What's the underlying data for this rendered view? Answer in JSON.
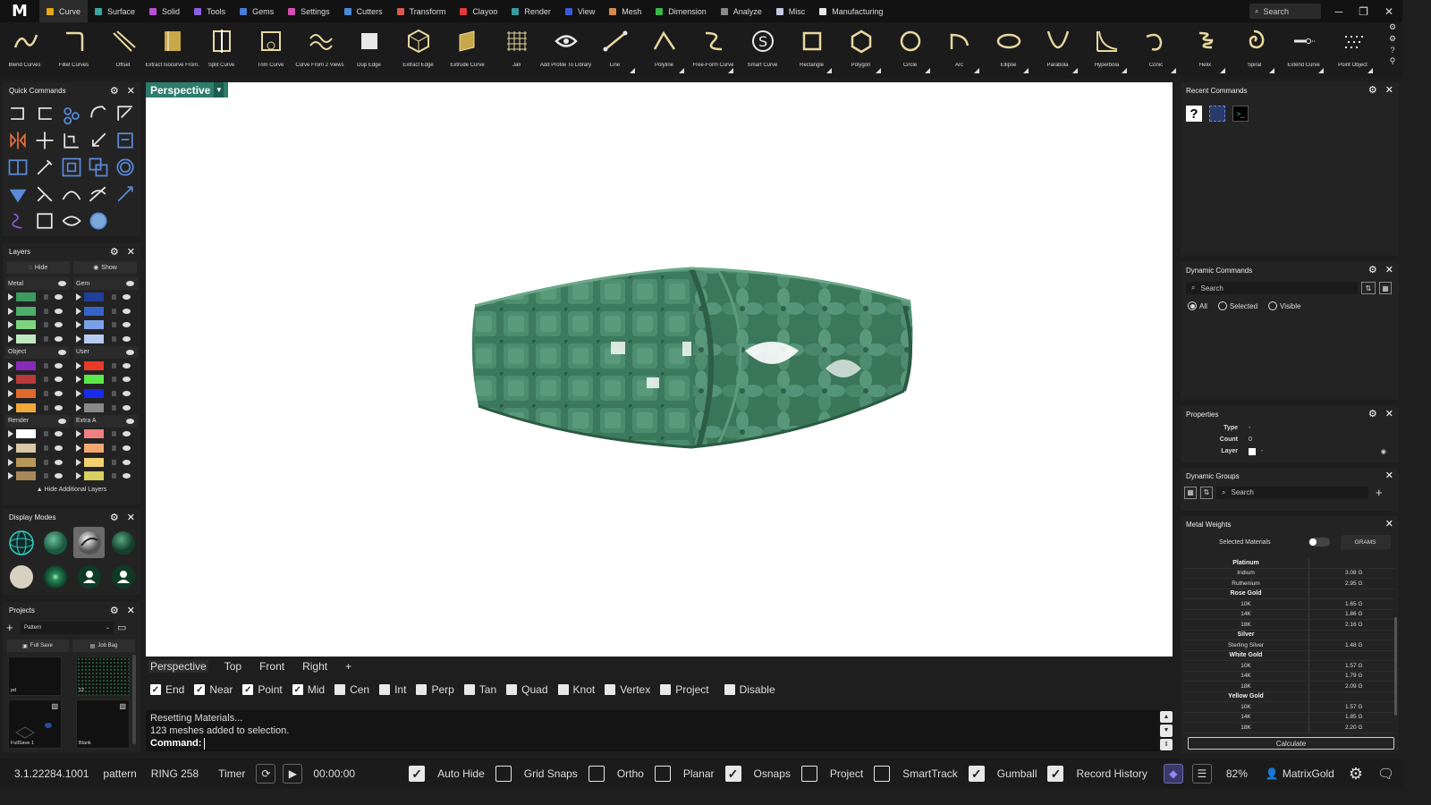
{
  "app": {
    "logo": "M"
  },
  "tabs": [
    {
      "label": "Curve",
      "color": "#e6a817",
      "active": true
    },
    {
      "label": "Surface",
      "color": "#3aa7a0"
    },
    {
      "label": "Solid",
      "color": "#b84fd6"
    },
    {
      "label": "Tools",
      "color": "#8a5fe0"
    },
    {
      "label": "Gems",
      "color": "#4a7bd8"
    },
    {
      "label": "Settings",
      "color": "#d64fb0"
    },
    {
      "label": "Cutters",
      "color": "#4a8ad8"
    },
    {
      "label": "Transform",
      "color": "#d65a4f"
    },
    {
      "label": "Clayoo",
      "color": "#e03a3a"
    },
    {
      "label": "Render",
      "color": "#3a9aa0"
    },
    {
      "label": "View",
      "color": "#3a5ad8"
    },
    {
      "label": "Mesh",
      "color": "#d68a4f"
    },
    {
      "label": "Dimension",
      "color": "#3ab84f"
    },
    {
      "label": "Analyze",
      "color": "#888888"
    },
    {
      "label": "Misc",
      "color": "#c8c8e8"
    },
    {
      "label": "Manufacturing",
      "color": "#e8e8e8"
    }
  ],
  "search": {
    "placeholder": "Search"
  },
  "window": {
    "minimize": "─",
    "restore": "❐",
    "close": "✕"
  },
  "tools": [
    {
      "label": "Blend Curves",
      "icon": "blend-curves",
      "corner": false
    },
    {
      "label": "Fillet Curves",
      "icon": "fillet-curves",
      "corner": false
    },
    {
      "label": "Offset",
      "icon": "offset",
      "corner": false
    },
    {
      "label": "Extract Isocurve From...",
      "icon": "extract-isocurve",
      "corner": false
    },
    {
      "label": "Split Curve",
      "icon": "split-curve",
      "corner": false
    },
    {
      "label": "Trim Curve",
      "icon": "trim-curve",
      "corner": false
    },
    {
      "label": "Curve From 2 Views",
      "icon": "curve-2-views",
      "corner": false
    },
    {
      "label": "Dup Edge",
      "icon": "dup-edge",
      "corner": false
    },
    {
      "label": "Extract Edge",
      "icon": "extract-edge",
      "corner": false
    },
    {
      "label": "Extrude Curve",
      "icon": "extrude-curve",
      "corner": false
    },
    {
      "label": "Jali",
      "icon": "jali",
      "corner": false
    },
    {
      "label": "Add Profile To Library",
      "icon": "add-profile",
      "corner": false
    },
    {
      "label": "Line",
      "icon": "line",
      "corner": true
    },
    {
      "label": "Polyline",
      "icon": "polyline",
      "corner": true
    },
    {
      "label": "Free-Form Curve",
      "icon": "free-form-curve",
      "corner": true
    },
    {
      "label": "Smart Curve",
      "icon": "smart-curve",
      "corner": false
    },
    {
      "label": "Rectangle",
      "icon": "rectangle",
      "corner": true
    },
    {
      "label": "Polygon",
      "icon": "polygon",
      "corner": true
    },
    {
      "label": "Circle",
      "icon": "circle",
      "corner": true
    },
    {
      "label": "Arc",
      "icon": "arc",
      "corner": true
    },
    {
      "label": "Ellipse",
      "icon": "ellipse",
      "corner": true
    },
    {
      "label": "Parabola",
      "icon": "parabola",
      "corner": true
    },
    {
      "label": "Hyperbola",
      "icon": "hyperbola",
      "corner": true
    },
    {
      "label": "Conic",
      "icon": "conic",
      "corner": true
    },
    {
      "label": "Helix",
      "icon": "helix",
      "corner": true
    },
    {
      "label": "Spiral",
      "icon": "spiral",
      "corner": true
    },
    {
      "label": "Extend Curve",
      "icon": "extend-curve",
      "corner": true
    },
    {
      "label": "Point Object",
      "icon": "point-object",
      "corner": true
    }
  ],
  "panels": {
    "quick_commands": "Quick Commands",
    "layers": "Layers",
    "display_modes": "Display Modes",
    "projects": "Projects",
    "recent_commands": "Recent Commands",
    "dynamic_commands": "Dynamic Commands",
    "properties": "Properties",
    "dynamic_groups": "Dynamic Groups",
    "metal_weights": "Metal Weights"
  },
  "layers": {
    "hide": "Hide",
    "show": "Show",
    "groups": [
      {
        "name": "Metal",
        "colors": [
          "#3c9a5f",
          "#4cae6b",
          "#7cd47e",
          "#bfe8c0"
        ]
      },
      {
        "name": "Gem",
        "colors": [
          "#1f3f9a",
          "#3564c8",
          "#7aa0e8",
          "#b8ccf0"
        ]
      },
      {
        "name": "Object",
        "colors": [
          "#8a2bb8",
          "#b83a3a",
          "#e06a2a",
          "#f0a83a"
        ]
      },
      {
        "name": "User",
        "colors": [
          "#e83a2a",
          "#5ae84a",
          "#1a2ae8",
          "#888888"
        ]
      },
      {
        "name": "Render",
        "colors": [
          "#ffffff",
          "#d8c8a8",
          "#b89858",
          "#a88858"
        ]
      },
      {
        "name": "Extra A",
        "colors": [
          "#f08080",
          "#f0a870",
          "#f0d070",
          "#d8d060"
        ]
      }
    ],
    "hide_additional": "Hide Additional Layers"
  },
  "projects": {
    "dropdown": "Pattern",
    "full_save": "Full Save",
    "job_bag": "Job Bag",
    "thumbs": [
      "pd",
      "12",
      "FullSave 1",
      "Blank"
    ]
  },
  "viewport": {
    "active_label": "Perspective",
    "tabs": [
      "Perspective",
      "Top",
      "Front",
      "Right",
      "+"
    ]
  },
  "snaps": [
    {
      "label": "End",
      "on": true
    },
    {
      "label": "Near",
      "on": true
    },
    {
      "label": "Point",
      "on": true
    },
    {
      "label": "Mid",
      "on": true
    },
    {
      "label": "Cen",
      "on": false
    },
    {
      "label": "Int",
      "on": false
    },
    {
      "label": "Perp",
      "on": false
    },
    {
      "label": "Tan",
      "on": false
    },
    {
      "label": "Quad",
      "on": false
    },
    {
      "label": "Knot",
      "on": false
    },
    {
      "label": "Vertex",
      "on": false
    },
    {
      "label": "Project",
      "on": false
    },
    {
      "label": "Disable",
      "on": false
    }
  ],
  "command": {
    "lines": [
      "Resetting Materials...",
      "123 meshes added to selection."
    ],
    "prompt": "Command:"
  },
  "dynamic_commands": {
    "search": "Search",
    "filters": [
      {
        "label": "All",
        "on": true
      },
      {
        "label": "Selected",
        "on": false
      },
      {
        "label": "Visible",
        "on": false
      }
    ]
  },
  "properties": {
    "rows": [
      {
        "k": "Type",
        "v": "-"
      },
      {
        "k": "Count",
        "v": "0"
      },
      {
        "k": "Layer",
        "v": "-"
      }
    ]
  },
  "dynamic_groups": {
    "search": "Search"
  },
  "metal_weights": {
    "selected_materials": "Selected Materials",
    "unit": "GRAMS",
    "calculate": "Calculate",
    "rows": [
      {
        "name": "Platinum",
        "group": true,
        "value": ""
      },
      {
        "name": "Iridium",
        "group": false,
        "value": "3.08 G"
      },
      {
        "name": "Ruthenium",
        "group": false,
        "value": "2.95 G"
      },
      {
        "name": "Rose Gold",
        "group": true,
        "value": ""
      },
      {
        "name": "10K",
        "group": false,
        "value": "1.65 G"
      },
      {
        "name": "14K",
        "group": false,
        "value": "1.86 G"
      },
      {
        "name": "18K",
        "group": false,
        "value": "2.16 G"
      },
      {
        "name": "Silver",
        "group": true,
        "value": ""
      },
      {
        "name": "Sterling Silver",
        "group": false,
        "value": "1.48 G"
      },
      {
        "name": "White Gold",
        "group": true,
        "value": ""
      },
      {
        "name": "10K",
        "group": false,
        "value": "1.57 G"
      },
      {
        "name": "14K",
        "group": false,
        "value": "1.79 G"
      },
      {
        "name": "18K",
        "group": false,
        "value": "2.09 G"
      },
      {
        "name": "Yellow Gold",
        "group": true,
        "value": ""
      },
      {
        "name": "10K",
        "group": false,
        "value": "1.57 G"
      },
      {
        "name": "14K",
        "group": false,
        "value": "1.85 G"
      },
      {
        "name": "18K",
        "group": false,
        "value": "2.20 G"
      }
    ]
  },
  "status": {
    "version": "3.1.22284.1001",
    "project": "pattern",
    "file": "RING 258",
    "timer_label": "Timer",
    "timer_value": "00:00:00",
    "toggles": [
      {
        "label": "Auto Hide",
        "on": true
      },
      {
        "label": "Grid Snaps",
        "on": false
      },
      {
        "label": "Ortho",
        "on": false
      },
      {
        "label": "Planar",
        "on": false
      },
      {
        "label": "Osnaps",
        "on": true
      },
      {
        "label": "Project",
        "on": false
      },
      {
        "label": "SmartTrack",
        "on": false
      },
      {
        "label": "Gumball",
        "on": true
      },
      {
        "label": "Record History",
        "on": true
      }
    ],
    "zoom": "82%",
    "user": "MatrixGold"
  }
}
